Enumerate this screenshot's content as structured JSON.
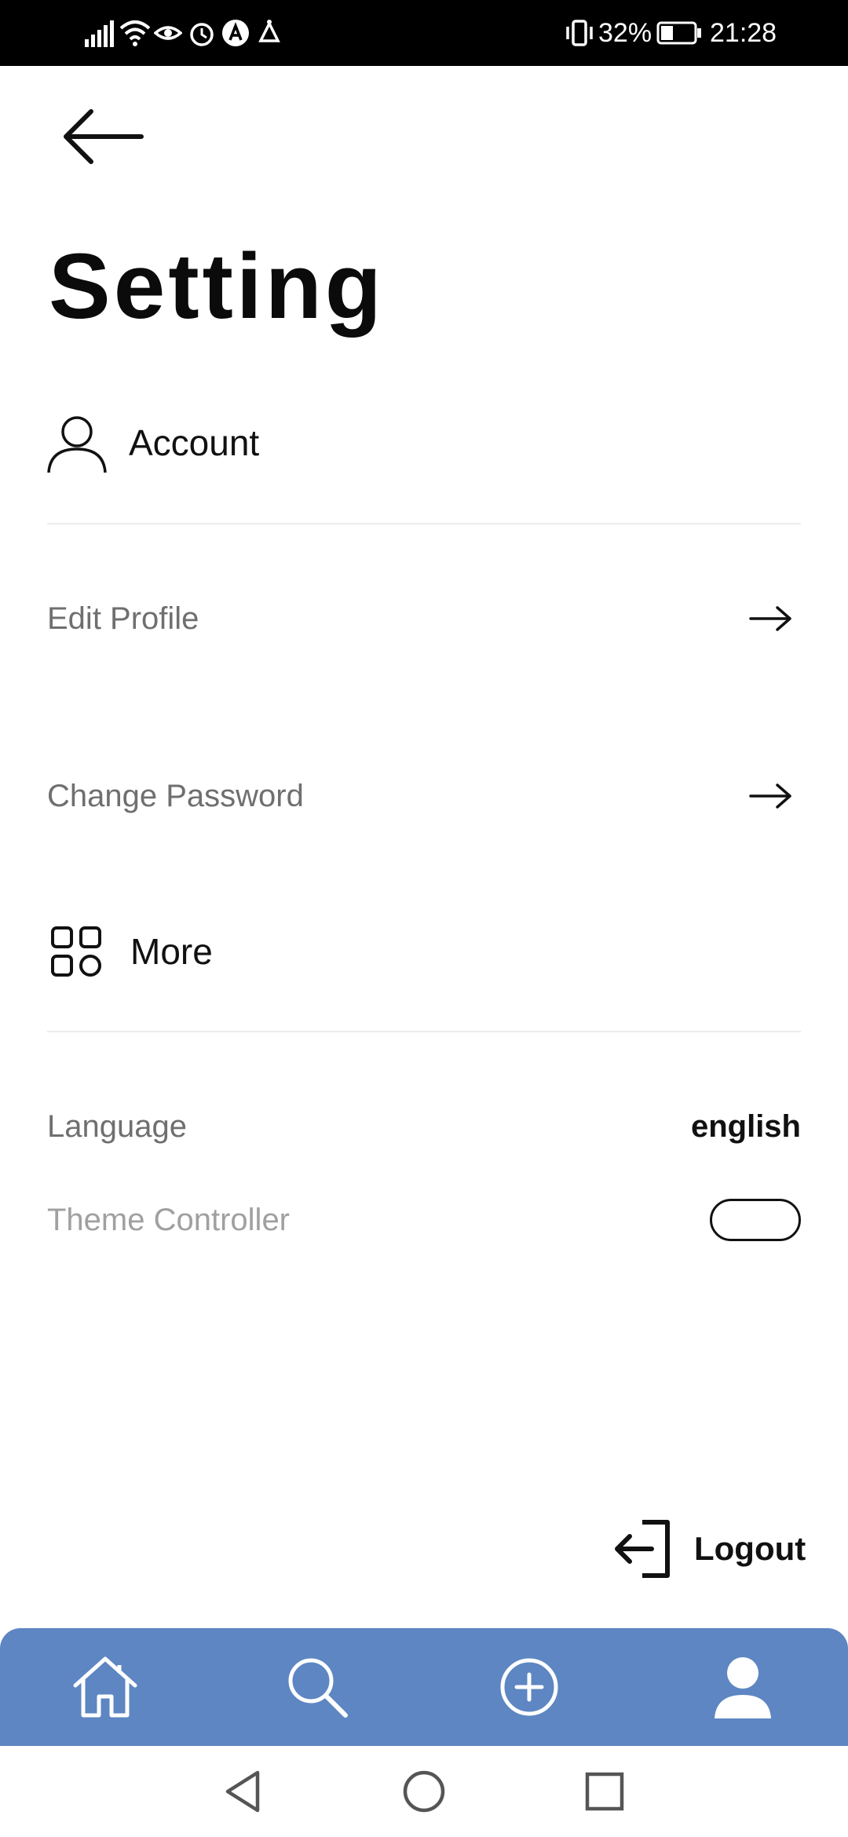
{
  "status_bar": {
    "battery_percent": "32%",
    "time": "21:28"
  },
  "header": {
    "title": "Setting"
  },
  "sections": {
    "account": {
      "label": "Account",
      "icon": "user-outline-icon",
      "items": [
        {
          "label": "Edit Profile",
          "icon": "arrow-right-icon"
        },
        {
          "label": "Change Password",
          "icon": "arrow-right-icon"
        }
      ]
    },
    "more": {
      "label": "More",
      "icon": "grid-icon",
      "language": {
        "label": "Language",
        "value": "english"
      },
      "theme": {
        "label": "Theme Controller",
        "enabled": false
      }
    }
  },
  "logout": {
    "label": "Logout",
    "icon": "logout-icon"
  },
  "bottom_nav": {
    "items": [
      {
        "name": "home",
        "icon": "home-icon"
      },
      {
        "name": "search",
        "icon": "search-icon"
      },
      {
        "name": "add",
        "icon": "add-circle-icon"
      },
      {
        "name": "profile",
        "icon": "person-icon"
      }
    ],
    "color": "#5d86c2"
  },
  "system_nav": {
    "items": [
      "back",
      "home",
      "recents"
    ]
  }
}
